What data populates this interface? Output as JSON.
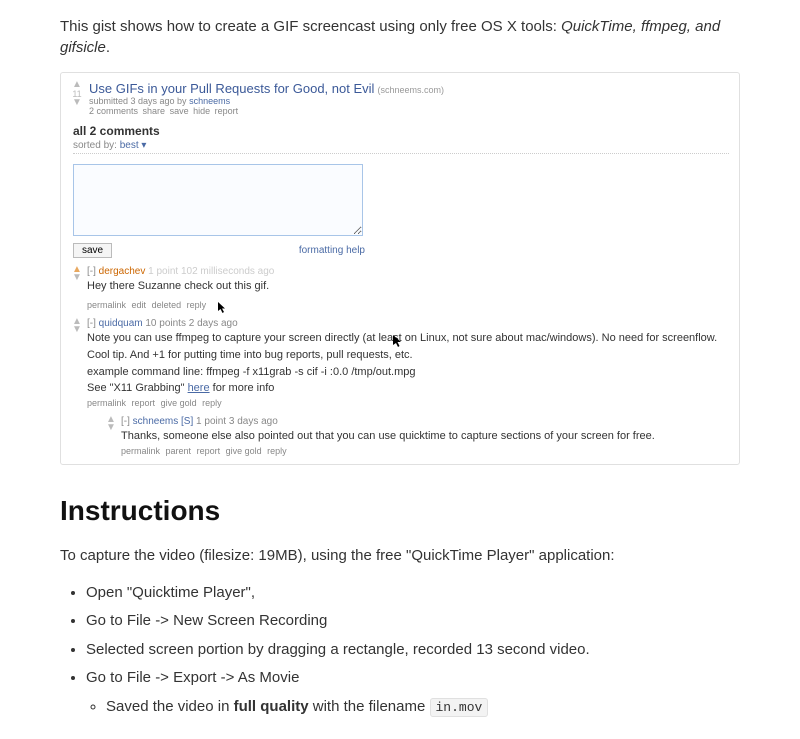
{
  "intro": {
    "prefix": "This gist shows how to create a GIF screencast using only free OS X tools: ",
    "tools": "QuickTime, ffmpeg, and gifsicle",
    "suffix": "."
  },
  "post": {
    "title": "Use GIFs in your Pull Requests for Good, not Evil",
    "domain": "(schneems.com)",
    "score": "11",
    "submitted_prefix": "submitted 3 days ago by ",
    "author": "schneems",
    "actions": {
      "comments": "2 comments",
      "share": "share",
      "save": "save",
      "hide": "hide",
      "report": "report"
    }
  },
  "comments_header": "all 2 comments",
  "sorted_by": {
    "label": "sorted by: ",
    "value": "best ▾"
  },
  "save_label": "save",
  "formatting_help": "formatting help",
  "c1": {
    "collapse": "[-]",
    "user": "dergachev",
    "meta": "1 point 102 milliseconds ago",
    "text": "Hey there Suzanne check out this gif.",
    "actions": {
      "permalink": "permalink",
      "edit": "edit",
      "deleted": "deleted",
      "reply": "reply"
    }
  },
  "c2": {
    "collapse": "[-]",
    "user": "quidquam",
    "meta": "10 points 2 days ago",
    "line1": "Note you can use ffmpeg to capture your screen directly (at least on Linux, not sure about mac/windows). No need for screenflow.",
    "line2": "Cool tip. And +1 for putting time into bug reports, pull requests, etc.",
    "line3": "example command line: ffmpeg -f x11grab -s cif -i :0.0 /tmp/out.mpg",
    "line4a": "See \"X11 Grabbing\" ",
    "line4_link": "here",
    "line4b": " for more info",
    "actions": {
      "permalink": "permalink",
      "report": "report",
      "givegold": "give gold",
      "reply": "reply"
    }
  },
  "c3": {
    "collapse": "[-]",
    "user": "schneems",
    "op": "[S]",
    "meta": "1 point 3 days ago",
    "text": "Thanks, someone else also pointed out that you can use quicktime to capture sections of your screen for free.",
    "actions": {
      "permalink": "permalink",
      "parent": "parent",
      "report": "report",
      "givegold": "give gold",
      "reply": "reply"
    }
  },
  "instructions_heading": "Instructions",
  "capture_line": "To capture the video (filesize: 19MB), using the free \"QuickTime Player\" application:",
  "steps": {
    "s1": "Open \"Quicktime Player\",",
    "s2": "Go to File -> New Screen Recording",
    "s3": "Selected screen portion by dragging a rectangle, recorded 13 second video.",
    "s4": "Go to File -> Export -> As Movie",
    "s4a_prefix": "Saved the video in ",
    "s4a_bold": "full quality",
    "s4a_mid": " with the filename ",
    "s4a_code": "in.mov"
  }
}
